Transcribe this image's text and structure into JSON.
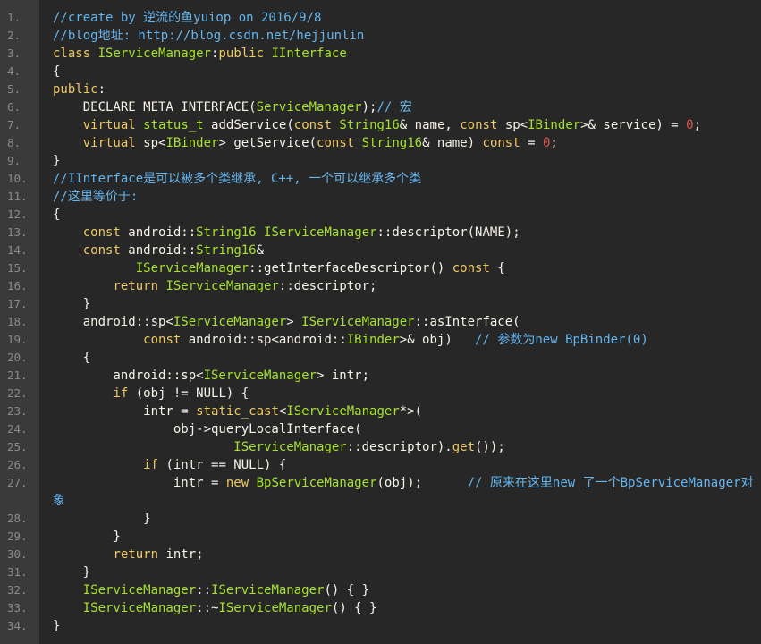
{
  "editor": {
    "lines": [
      {
        "n": "1.",
        "tokens": [
          {
            "t": "comment",
            "v": "//create by 逆流的鱼yuiop on 2016/9/8"
          }
        ]
      },
      {
        "n": "2.",
        "tokens": [
          {
            "t": "comment",
            "v": "//blog地址: http://blog.csdn.net/hejjunlin"
          }
        ]
      },
      {
        "n": "3.",
        "tokens": [
          {
            "t": "keyword",
            "v": "class"
          },
          {
            "t": "plain",
            "v": " "
          },
          {
            "t": "type",
            "v": "IServiceManager"
          },
          {
            "t": "plain",
            "v": ":"
          },
          {
            "t": "keyword",
            "v": "public"
          },
          {
            "t": "plain",
            "v": " "
          },
          {
            "t": "type",
            "v": "IInterface"
          }
        ]
      },
      {
        "n": "4.",
        "tokens": [
          {
            "t": "plain",
            "v": "{"
          }
        ]
      },
      {
        "n": "5.",
        "tokens": [
          {
            "t": "keyword",
            "v": "public"
          },
          {
            "t": "plain",
            "v": ":"
          }
        ]
      },
      {
        "n": "6.",
        "tokens": [
          {
            "t": "plain",
            "v": "    DECLARE_META_INTERFACE("
          },
          {
            "t": "type",
            "v": "ServiceManager"
          },
          {
            "t": "plain",
            "v": ");"
          },
          {
            "t": "comment",
            "v": "// 宏"
          }
        ]
      },
      {
        "n": "7.",
        "tokens": [
          {
            "t": "plain",
            "v": "    "
          },
          {
            "t": "keyword",
            "v": "virtual"
          },
          {
            "t": "plain",
            "v": " "
          },
          {
            "t": "type",
            "v": "status_t"
          },
          {
            "t": "plain",
            "v": " addService("
          },
          {
            "t": "keyword",
            "v": "const"
          },
          {
            "t": "plain",
            "v": " "
          },
          {
            "t": "type",
            "v": "String16"
          },
          {
            "t": "plain",
            "v": "& name, "
          },
          {
            "t": "keyword",
            "v": "const"
          },
          {
            "t": "plain",
            "v": " sp<"
          },
          {
            "t": "type",
            "v": "IBinder"
          },
          {
            "t": "plain",
            "v": ">& service) = "
          },
          {
            "t": "number",
            "v": "0"
          },
          {
            "t": "plain",
            "v": ";"
          }
        ]
      },
      {
        "n": "8.",
        "tokens": [
          {
            "t": "plain",
            "v": "    "
          },
          {
            "t": "keyword",
            "v": "virtual"
          },
          {
            "t": "plain",
            "v": " sp<"
          },
          {
            "t": "type",
            "v": "IBinder"
          },
          {
            "t": "plain",
            "v": "> getService("
          },
          {
            "t": "keyword",
            "v": "const"
          },
          {
            "t": "plain",
            "v": " "
          },
          {
            "t": "type",
            "v": "String16"
          },
          {
            "t": "plain",
            "v": "& name) "
          },
          {
            "t": "keyword",
            "v": "const"
          },
          {
            "t": "plain",
            "v": " = "
          },
          {
            "t": "number",
            "v": "0"
          },
          {
            "t": "plain",
            "v": ";"
          }
        ]
      },
      {
        "n": "9.",
        "tokens": [
          {
            "t": "plain",
            "v": "}"
          }
        ]
      },
      {
        "n": "10.",
        "tokens": [
          {
            "t": "comment",
            "v": "//IInterface是可以被多个类继承, C++, 一个可以继承多个类"
          }
        ]
      },
      {
        "n": "11.",
        "tokens": [
          {
            "t": "comment",
            "v": "//这里等价于:"
          }
        ]
      },
      {
        "n": "12.",
        "tokens": [
          {
            "t": "plain",
            "v": "{"
          }
        ]
      },
      {
        "n": "13.",
        "tokens": [
          {
            "t": "plain",
            "v": "    "
          },
          {
            "t": "keyword",
            "v": "const"
          },
          {
            "t": "plain",
            "v": " android::"
          },
          {
            "t": "type",
            "v": "String16"
          },
          {
            "t": "plain",
            "v": " "
          },
          {
            "t": "type",
            "v": "IServiceManager"
          },
          {
            "t": "plain",
            "v": "::descriptor(NAME);"
          }
        ]
      },
      {
        "n": "14.",
        "tokens": [
          {
            "t": "plain",
            "v": "    "
          },
          {
            "t": "keyword",
            "v": "const"
          },
          {
            "t": "plain",
            "v": " android::"
          },
          {
            "t": "type",
            "v": "String16"
          },
          {
            "t": "plain",
            "v": "&"
          }
        ]
      },
      {
        "n": "15.",
        "tokens": [
          {
            "t": "plain",
            "v": "           "
          },
          {
            "t": "type",
            "v": "IServiceManager"
          },
          {
            "t": "plain",
            "v": "::getInterfaceDescriptor() "
          },
          {
            "t": "keyword",
            "v": "const"
          },
          {
            "t": "plain",
            "v": " {"
          }
        ]
      },
      {
        "n": "16.",
        "tokens": [
          {
            "t": "plain",
            "v": "        "
          },
          {
            "t": "keyword",
            "v": "return"
          },
          {
            "t": "plain",
            "v": " "
          },
          {
            "t": "type",
            "v": "IServiceManager"
          },
          {
            "t": "plain",
            "v": "::descriptor;"
          }
        ]
      },
      {
        "n": "17.",
        "tokens": [
          {
            "t": "plain",
            "v": "    }"
          }
        ]
      },
      {
        "n": "18.",
        "tokens": [
          {
            "t": "plain",
            "v": "    android::sp<"
          },
          {
            "t": "type",
            "v": "IServiceManager"
          },
          {
            "t": "plain",
            "v": "> "
          },
          {
            "t": "type",
            "v": "IServiceManager"
          },
          {
            "t": "plain",
            "v": "::asInterface("
          }
        ]
      },
      {
        "n": "19.",
        "tokens": [
          {
            "t": "plain",
            "v": "            "
          },
          {
            "t": "keyword",
            "v": "const"
          },
          {
            "t": "plain",
            "v": " android::sp<android::"
          },
          {
            "t": "type",
            "v": "IBinder"
          },
          {
            "t": "plain",
            "v": ">& obj)   "
          },
          {
            "t": "comment",
            "v": "// 参数为new BpBinder(0)"
          }
        ]
      },
      {
        "n": "20.",
        "tokens": [
          {
            "t": "plain",
            "v": "    {"
          }
        ]
      },
      {
        "n": "21.",
        "tokens": [
          {
            "t": "plain",
            "v": "        android::sp<"
          },
          {
            "t": "type",
            "v": "IServiceManager"
          },
          {
            "t": "plain",
            "v": "> intr;"
          }
        ]
      },
      {
        "n": "22.",
        "tokens": [
          {
            "t": "plain",
            "v": "        "
          },
          {
            "t": "keyword",
            "v": "if"
          },
          {
            "t": "plain",
            "v": " (obj != NULL) {"
          }
        ]
      },
      {
        "n": "23.",
        "tokens": [
          {
            "t": "plain",
            "v": "            intr = "
          },
          {
            "t": "keyword",
            "v": "static_cast"
          },
          {
            "t": "plain",
            "v": "<"
          },
          {
            "t": "type",
            "v": "IServiceManager"
          },
          {
            "t": "plain",
            "v": "*>("
          }
        ]
      },
      {
        "n": "24.",
        "tokens": [
          {
            "t": "plain",
            "v": "                obj->queryLocalInterface("
          }
        ]
      },
      {
        "n": "25.",
        "tokens": [
          {
            "t": "plain",
            "v": "                        "
          },
          {
            "t": "type",
            "v": "IServiceManager"
          },
          {
            "t": "plain",
            "v": "::descriptor)."
          },
          {
            "t": "keyword",
            "v": "get"
          },
          {
            "t": "plain",
            "v": "());"
          }
        ]
      },
      {
        "n": "26.",
        "tokens": [
          {
            "t": "plain",
            "v": "            "
          },
          {
            "t": "keyword",
            "v": "if"
          },
          {
            "t": "plain",
            "v": " (intr == NULL) {"
          }
        ]
      },
      {
        "n": "27.",
        "tokens": [
          {
            "t": "plain",
            "v": "                intr = "
          },
          {
            "t": "keyword",
            "v": "new"
          },
          {
            "t": "plain",
            "v": " "
          },
          {
            "t": "type",
            "v": "BpServiceManager"
          },
          {
            "t": "plain",
            "v": "(obj);      "
          },
          {
            "t": "comment",
            "v": "// 原来在这里new 了一个BpServiceManager对象"
          }
        ],
        "wrapped": true
      },
      {
        "n": "28.",
        "tokens": [
          {
            "t": "plain",
            "v": "            }"
          }
        ]
      },
      {
        "n": "29.",
        "tokens": [
          {
            "t": "plain",
            "v": "        }"
          }
        ]
      },
      {
        "n": "30.",
        "tokens": [
          {
            "t": "plain",
            "v": "        "
          },
          {
            "t": "keyword",
            "v": "return"
          },
          {
            "t": "plain",
            "v": " intr;"
          }
        ]
      },
      {
        "n": "31.",
        "tokens": [
          {
            "t": "plain",
            "v": "    }"
          }
        ]
      },
      {
        "n": "32.",
        "tokens": [
          {
            "t": "plain",
            "v": "    "
          },
          {
            "t": "type",
            "v": "IServiceManager"
          },
          {
            "t": "plain",
            "v": "::"
          },
          {
            "t": "type",
            "v": "IServiceManager"
          },
          {
            "t": "plain",
            "v": "() { }"
          }
        ]
      },
      {
        "n": "33.",
        "tokens": [
          {
            "t": "plain",
            "v": "    "
          },
          {
            "t": "type",
            "v": "IServiceManager"
          },
          {
            "t": "plain",
            "v": "::~"
          },
          {
            "t": "type",
            "v": "IServiceManager"
          },
          {
            "t": "plain",
            "v": "() { }"
          }
        ]
      },
      {
        "n": "34.",
        "tokens": [
          {
            "t": "plain",
            "v": "}"
          }
        ]
      }
    ]
  }
}
